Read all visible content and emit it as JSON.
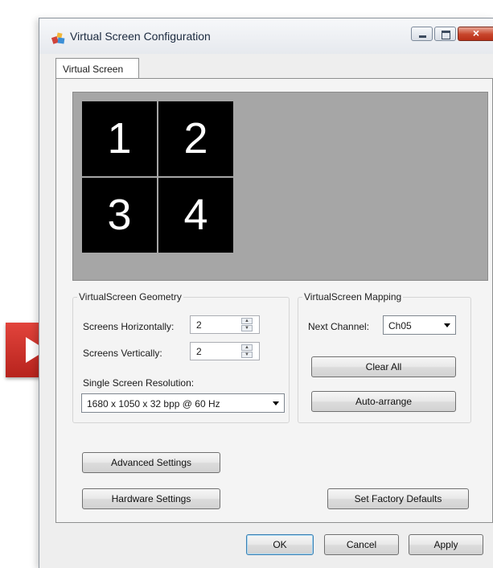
{
  "window": {
    "title": "Virtual Screen Configuration"
  },
  "tab": {
    "label": "Virtual Screen"
  },
  "preview": {
    "tiles": [
      "1",
      "2",
      "3",
      "4"
    ]
  },
  "geometry": {
    "legend": "VirtualScreen Geometry",
    "horizontal_label": "Screens Horizontally:",
    "horizontal_value": "2",
    "vertical_label": "Screens Vertically:",
    "vertical_value": "2",
    "resolution_label": "Single Screen Resolution:",
    "resolution_value": "1680 x 1050 x 32 bpp @ 60 Hz"
  },
  "mapping": {
    "legend": "VirtualScreen Mapping",
    "next_channel_label": "Next Channel:",
    "next_channel_value": "Ch05",
    "clear_all_label": "Clear All",
    "auto_arrange_label": "Auto-arrange"
  },
  "buttons": {
    "advanced_settings": "Advanced Settings",
    "hardware_settings": "Hardware Settings",
    "set_factory_defaults": "Set Factory Defaults",
    "ok": "OK",
    "cancel": "Cancel",
    "apply": "Apply"
  },
  "colors": {
    "preview_background": "#a6a6a6",
    "tile_background": "#000000",
    "play_overlay": "#d2302a",
    "close_button": "#c7452b"
  },
  "icons": {
    "app": "app-icon",
    "overlay": "play-icon"
  }
}
